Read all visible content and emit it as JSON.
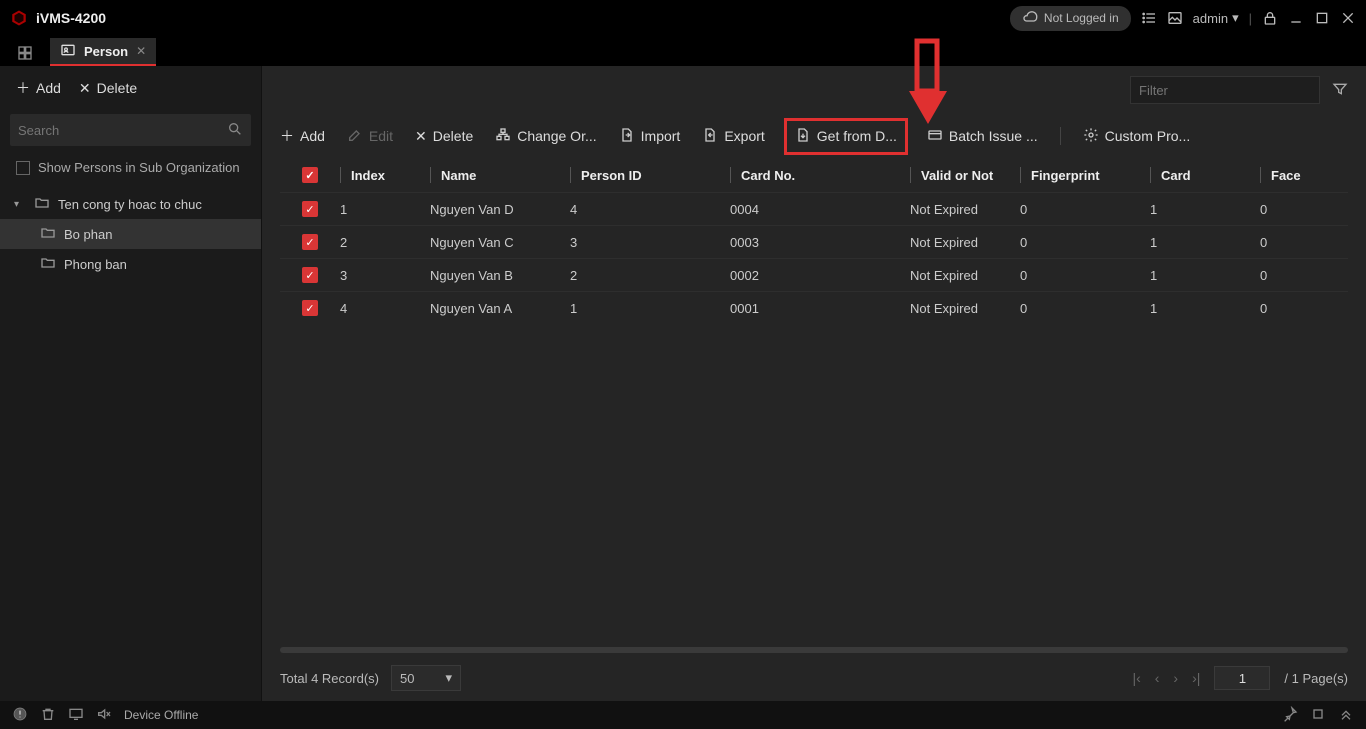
{
  "app_title": "iVMS-4200",
  "cloud_status": "Not Logged in",
  "admin_label": "admin",
  "tab": {
    "label": "Person"
  },
  "sidebar": {
    "add_label": "Add",
    "delete_label": "Delete",
    "search_placeholder": "Search",
    "show_sub_label": "Show Persons in Sub Organization",
    "tree": {
      "root": "Ten cong ty hoac to chuc",
      "children": [
        "Bo phan",
        "Phong ban"
      ]
    }
  },
  "filter_placeholder": "Filter",
  "toolbar": {
    "add": "Add",
    "edit": "Edit",
    "delete": "Delete",
    "change_org": "Change Or...",
    "import": "Import",
    "export": "Export",
    "get_from_device": "Get from D...",
    "batch_issue": "Batch Issue ...",
    "custom_prop": "Custom Pro..."
  },
  "table": {
    "headers": {
      "index": "Index",
      "name": "Name",
      "person_id": "Person ID",
      "card_no": "Card No.",
      "valid": "Valid or Not",
      "fingerprint": "Fingerprint",
      "card": "Card",
      "face": "Face"
    },
    "rows": [
      {
        "index": "1",
        "name": "Nguyen Van D",
        "pid": "4",
        "card": "0004",
        "valid": "Not Expired",
        "fp": "0",
        "cardct": "1",
        "face": "0"
      },
      {
        "index": "2",
        "name": "Nguyen Van C",
        "pid": "3",
        "card": "0003",
        "valid": "Not Expired",
        "fp": "0",
        "cardct": "1",
        "face": "0"
      },
      {
        "index": "3",
        "name": "Nguyen Van B",
        "pid": "2",
        "card": "0002",
        "valid": "Not Expired",
        "fp": "0",
        "cardct": "1",
        "face": "0"
      },
      {
        "index": "4",
        "name": "Nguyen Van A",
        "pid": "1",
        "card": "0001",
        "valid": "Not Expired",
        "fp": "0",
        "cardct": "1",
        "face": "0"
      }
    ]
  },
  "pager": {
    "total_label": "Total 4 Record(s)",
    "page_size": "50",
    "current_page": "1",
    "total_pages_label": "/ 1 Page(s)"
  },
  "status": {
    "device_offline": "Device Offline"
  }
}
